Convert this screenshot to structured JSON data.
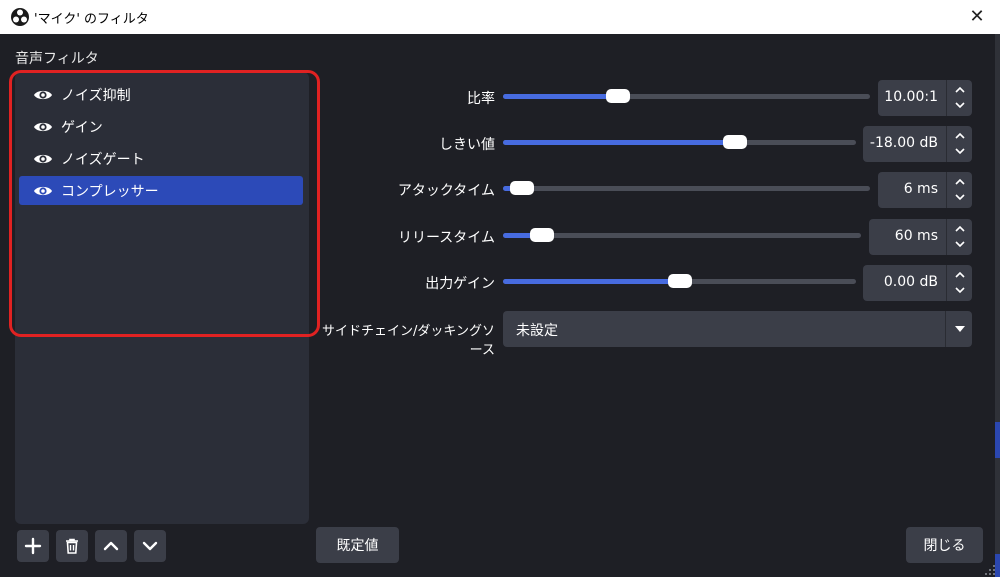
{
  "window": {
    "title": "'マイク' のフィルタ",
    "close_glyph": "✕"
  },
  "left": {
    "section_label": "音声フィルタ",
    "filters": [
      {
        "label": "ノイズ抑制",
        "visible_icon": "eye-icon",
        "selected": false
      },
      {
        "label": "ゲイン",
        "visible_icon": "eye-icon",
        "selected": false
      },
      {
        "label": "ノイズゲート",
        "visible_icon": "eye-icon",
        "selected": false
      },
      {
        "label": "コンプレッサー",
        "visible_icon": "eye-icon",
        "selected": true
      }
    ],
    "toolbar": [
      "plus-icon",
      "trash-icon",
      "chevron-up-icon",
      "chevron-down-icon"
    ]
  },
  "params": [
    {
      "label": "比率",
      "value": "10.00:1",
      "level": 0.3
    },
    {
      "label": "しきい値",
      "value": "-18.00 dB",
      "level": 0.67
    },
    {
      "label": "アタックタイム",
      "value": "6 ms",
      "level": 0.02
    },
    {
      "label": "リリースタイム",
      "value": "60 ms",
      "level": 0.08
    },
    {
      "label": "出力ゲイン",
      "value": "0.00 dB",
      "level": 0.5
    }
  ],
  "sidechain": {
    "label": "サイドチェイン/ダッキングソース",
    "value": "未設定"
  },
  "buttons": {
    "defaults": "既定値",
    "close": "閉じる"
  },
  "colors": {
    "accent": "#476be0",
    "selection": "#2c4ab8",
    "highlight_box": "#e02222"
  }
}
